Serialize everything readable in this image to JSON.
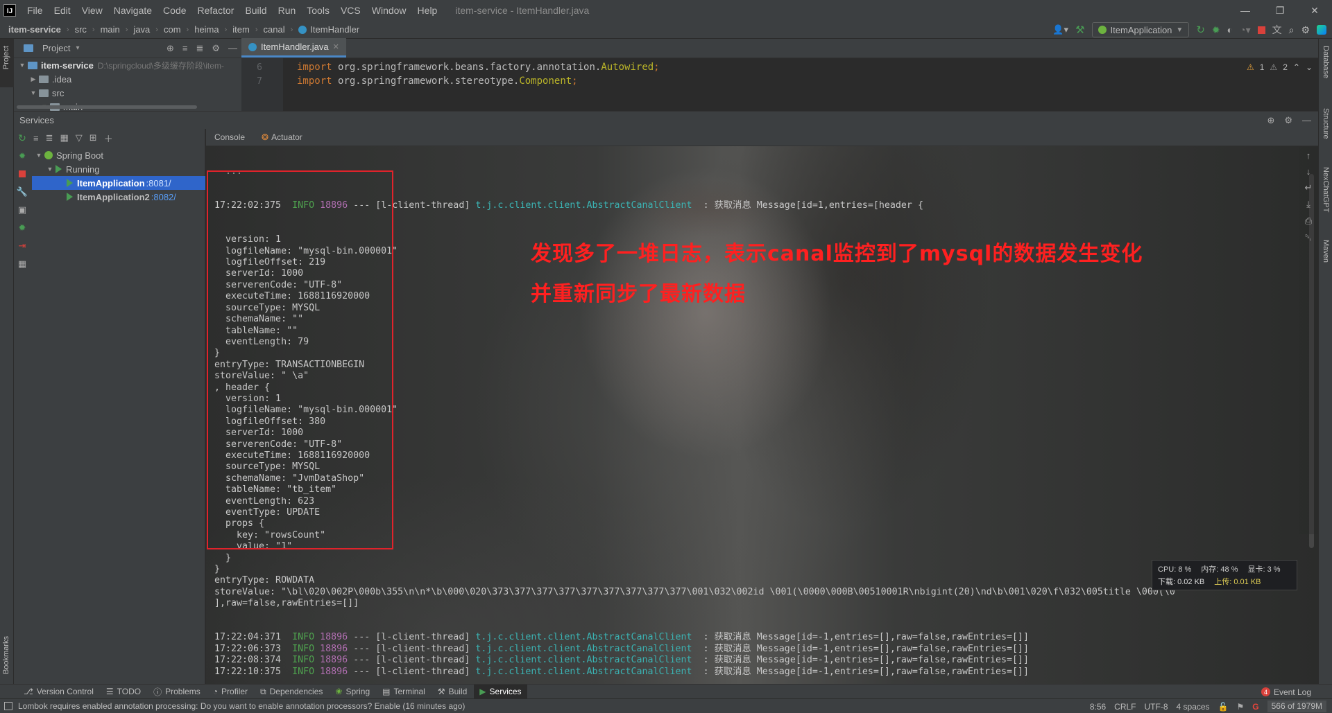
{
  "app": {
    "window_title": "item-service - ItemHandler.java",
    "logo": "IJ",
    "menu": [
      "File",
      "Edit",
      "View",
      "Navigate",
      "Code",
      "Refactor",
      "Build",
      "Run",
      "Tools",
      "VCS",
      "Window",
      "Help"
    ]
  },
  "navbar": {
    "breadcrumbs": [
      "item-service",
      "src",
      "main",
      "java",
      "com",
      "heima",
      "item",
      "canal",
      "ItemHandler"
    ],
    "run_config": "ItemApplication"
  },
  "left_stripe": {
    "project": "Project",
    "bookmarks": "Bookmarks"
  },
  "right_stripe": [
    "Database",
    "Structure",
    "NexChatGPT",
    "Maven"
  ],
  "project_panel": {
    "title": "Project",
    "root": "item-service",
    "root_path": "D:\\springcloud\\多级缓存阶段\\item-",
    "items": [
      ".idea",
      "src",
      "main"
    ]
  },
  "editor": {
    "tab": "ItemHandler.java",
    "lines": [
      {
        "num": "6",
        "kw": "import ",
        "pkg": "org.springframework.beans.factory.annotation.",
        "cls": "Autowired",
        "end": ";"
      },
      {
        "num": "7",
        "kw": "import ",
        "pkg": "org.springframework.stereotype.",
        "cls": "Component",
        "end": ";"
      }
    ],
    "warnings": "1",
    "weak_warnings": "2"
  },
  "services": {
    "title": "Services",
    "tree": {
      "group": "Spring Boot",
      "state": "Running",
      "apps": [
        {
          "name": "ItemApplication",
          "port": ":8081/"
        },
        {
          "name": "ItemApplication2",
          "port": ":8082/"
        }
      ]
    },
    "tabs": [
      "Console",
      "Actuator"
    ]
  },
  "console": {
    "first_log": {
      "time": "17:22:02:375",
      "level": "INFO",
      "pid": "18896",
      "sep": "---",
      "thread": "[l-client-thread]",
      "logger": "t.j.c.client.client.AbstractCanalClient",
      "msg": ": 获取消息 Message[id=1,entries=[header {"
    },
    "body": [
      "  version: 1",
      "  logfileName: \"mysql-bin.000001\"",
      "  logfileOffset: 219",
      "  serverId: 1000",
      "  serverenCode: \"UTF-8\"",
      "  executeTime: 1688116920000",
      "  sourceType: MYSQL",
      "  schemaName: \"\"",
      "  tableName: \"\"",
      "  eventLength: 79",
      "}",
      "entryType: TRANSACTIONBEGIN",
      "storeValue: \" \\a\"",
      ", header {",
      "  version: 1",
      "  logfileName: \"mysql-bin.000001\"",
      "  logfileOffset: 380",
      "  serverId: 1000",
      "  serverenCode: \"UTF-8\"",
      "  executeTime: 1688116920000",
      "  sourceType: MYSQL",
      "  schemaName: \"JvmDataShop\"",
      "  tableName: \"tb_item\"",
      "  eventLength: 623",
      "  eventType: UPDATE",
      "  props {",
      "    key: \"rowsCount\"",
      "    value: \"1\"",
      "  }",
      "}",
      "entryType: ROWDATA",
      "storeValue: \"\\bl\\020\\002P\\000b\\355\\n\\n*\\b\\000\\020\\373\\377\\377\\377\\377\\377\\377\\377\\377\\001\\032\\002id \\001(\\0000\\000B\\00510001R\\nbigint(20)\\nd\\b\\001\\020\\f\\032\\005title \\000(\\0",
      "],raw=false,rawEntries=[]]"
    ],
    "later_logs": [
      {
        "time": "17:22:04:371",
        "level": "INFO",
        "pid": "18896",
        "sep": "---",
        "thread": "[l-client-thread]",
        "logger": "t.j.c.client.client.AbstractCanalClient",
        "msg": ": 获取消息 Message[id=-1,entries=[],raw=false,rawEntries=[]]"
      },
      {
        "time": "17:22:06:373",
        "level": "INFO",
        "pid": "18896",
        "sep": "---",
        "thread": "[l-client-thread]",
        "logger": "t.j.c.client.client.AbstractCanalClient",
        "msg": ": 获取消息 Message[id=-1,entries=[],raw=false,rawEntries=[]]"
      },
      {
        "time": "17:22:08:374",
        "level": "INFO",
        "pid": "18896",
        "sep": "---",
        "thread": "[l-client-thread]",
        "logger": "t.j.c.client.client.AbstractCanalClient",
        "msg": ": 获取消息 Message[id=-1,entries=[],raw=false,rawEntries=[]]"
      },
      {
        "time": "17:22:10:375",
        "level": "INFO",
        "pid": "18896",
        "sep": "---",
        "thread": "[l-client-thread]",
        "logger": "t.j.c.client.client.AbstractCanalClient",
        "msg": ": 获取消息 Message[id=-1,entries=[],raw=false,rawEntries=[]]"
      }
    ],
    "annotation_line1": "发现多了一堆日志，表示canal监控到了mysql的数据发生变化",
    "annotation_line2": "并重新同步了最新数据"
  },
  "perf": {
    "cpu": "CPU: 8 %",
    "mem": "内存: 48 %",
    "gpu": "显卡: 3 %",
    "down": "下载: 0.02 KB",
    "up": "上传: 0.01 KB"
  },
  "tool_tabs": [
    "Version Control",
    "TODO",
    "Problems",
    "Profiler",
    "Dependencies",
    "Spring",
    "Terminal",
    "Build",
    "Services"
  ],
  "event_log": {
    "label": "Event Log",
    "count": "4"
  },
  "status": {
    "message": "Lombok requires enabled annotation processing: Do you want to enable annotation processors? Enable (16 minutes ago)",
    "position": "8:56",
    "line_sep": "CRLF",
    "encoding": "UTF-8",
    "indent": "4 spaces",
    "memory": "566 of 1979M"
  },
  "colors": {
    "accent": "#2f65ca",
    "run": "#499c54",
    "highlight": "#e0232b",
    "annotation": "#ff2020"
  }
}
